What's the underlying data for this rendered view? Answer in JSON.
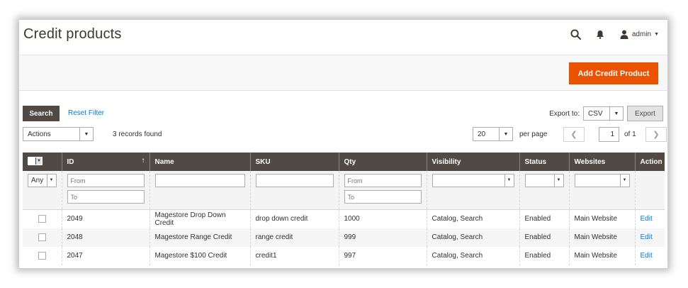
{
  "header": {
    "title": "Credit products",
    "user_name": "admin"
  },
  "action_bar": {
    "add_button_label": "Add Credit Product"
  },
  "toolbar": {
    "search_label": "Search",
    "reset_filter_label": "Reset Filter",
    "export_to_label": "Export to:",
    "export_format": "CSV",
    "export_button_label": "Export",
    "actions_label": "Actions",
    "records_found": "3 records found",
    "per_page_value": "20",
    "per_page_label": "per page",
    "current_page": "1",
    "page_of": "of 1"
  },
  "grid": {
    "columns": [
      "ID",
      "Name",
      "SKU",
      "Qty",
      "Visibility",
      "Status",
      "Websites",
      "Action"
    ],
    "filters": {
      "select_any": "Any",
      "id_from_placeholder": "From",
      "id_to_placeholder": "To",
      "qty_from_placeholder": "From",
      "qty_to_placeholder": "To"
    },
    "rows": [
      {
        "id": "2049",
        "name": "Magestore Drop Down Credit",
        "sku": "drop down credit",
        "qty": "1000",
        "visibility": "Catalog, Search",
        "status": "Enabled",
        "websites": "Main Website",
        "action": "Edit"
      },
      {
        "id": "2048",
        "name": "Magestore Range Credit",
        "sku": "range credit",
        "qty": "999",
        "visibility": "Catalog, Search",
        "status": "Enabled",
        "websites": "Main Website",
        "action": "Edit"
      },
      {
        "id": "2047",
        "name": "Magestore $100 Credit",
        "sku": "credit1",
        "qty": "997",
        "visibility": "Catalog, Search",
        "status": "Enabled",
        "websites": "Main Website",
        "action": "Edit"
      }
    ]
  },
  "colors": {
    "accent": "#eb5202",
    "header_dark": "#514943",
    "link": "#007bdb"
  }
}
